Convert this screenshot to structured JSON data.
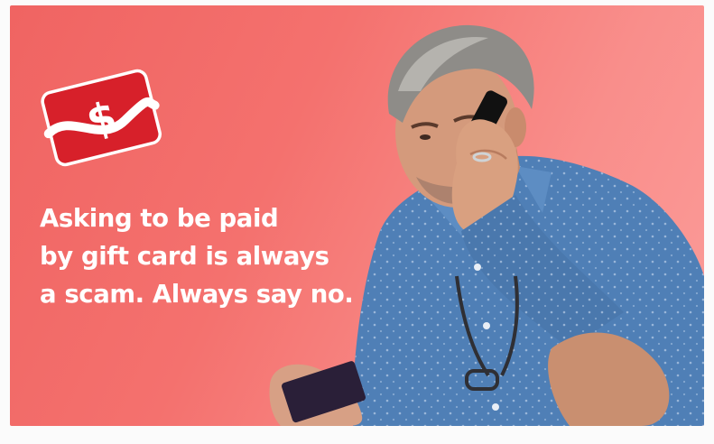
{
  "headline": {
    "line1": "Asking to be paid",
    "line2": "by gift card is always",
    "line3": "a scam. Always say no."
  },
  "icons": {
    "gift_card": "gift-card-dollar-icon"
  },
  "colors": {
    "background_start": "#f06462",
    "background_end": "#fb9c99",
    "card_red": "#d7202a",
    "text": "#ffffff",
    "shirt_blue": "#4f7fb6"
  }
}
